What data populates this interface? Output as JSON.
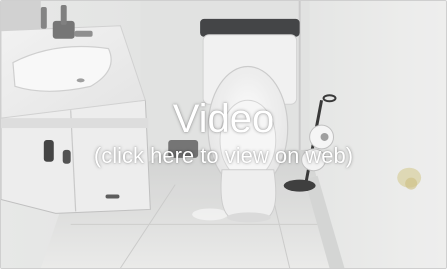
{
  "video_link": {
    "title": "Video",
    "subtitle": "(click here to view on web)"
  },
  "thumbnail": {
    "subject": "bathroom-with-toilet-vanity-and-toilet-paper-stand"
  }
}
